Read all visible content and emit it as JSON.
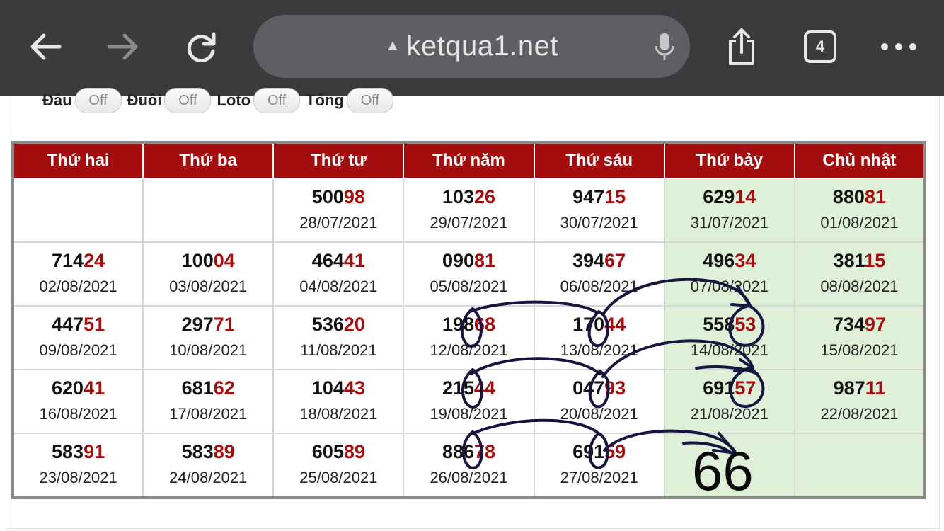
{
  "browser": {
    "url": "ketqua1.net",
    "tab_count": "4",
    "icons": [
      "back-icon",
      "forward-icon",
      "reload-icon",
      "warning-icon",
      "mic-icon",
      "share-icon",
      "tabs-icon",
      "more-icon"
    ]
  },
  "toggles": [
    {
      "label": "Đầu",
      "state": "Off"
    },
    {
      "label": "Đuôi",
      "state": "Off"
    },
    {
      "label": "Loto",
      "state": "Off"
    },
    {
      "label": "Tổng",
      "state": "Off"
    }
  ],
  "table": {
    "headers": [
      "Thứ hai",
      "Thứ ba",
      "Thứ tư",
      "Thứ năm",
      "Thứ sáu",
      "Thứ bảy",
      "Chủ nhật"
    ],
    "rows": [
      [
        null,
        null,
        {
          "pre": "500",
          "hl": "98",
          "date": "28/07/2021"
        },
        {
          "pre": "103",
          "hl": "26",
          "date": "29/07/2021"
        },
        {
          "pre": "947",
          "hl": "15",
          "date": "30/07/2021"
        },
        {
          "pre": "629",
          "hl": "14",
          "date": "31/07/2021"
        },
        {
          "pre": "880",
          "hl": "81",
          "date": "01/08/2021"
        }
      ],
      [
        {
          "pre": "714",
          "hl": "24",
          "date": "02/08/2021"
        },
        {
          "pre": "100",
          "hl": "04",
          "date": "03/08/2021"
        },
        {
          "pre": "464",
          "hl": "41",
          "date": "04/08/2021"
        },
        {
          "pre": "090",
          "hl": "81",
          "date": "05/08/2021"
        },
        {
          "pre": "394",
          "hl": "67",
          "date": "06/08/2021"
        },
        {
          "pre": "496",
          "hl": "34",
          "date": "07/08/2021"
        },
        {
          "pre": "381",
          "hl": "15",
          "date": "08/08/2021"
        }
      ],
      [
        {
          "pre": "447",
          "hl": "51",
          "date": "09/08/2021"
        },
        {
          "pre": "297",
          "hl": "71",
          "date": "10/08/2021"
        },
        {
          "pre": "536",
          "hl": "20",
          "date": "11/08/2021"
        },
        {
          "pre": "198",
          "hl": "68",
          "date": "12/08/2021"
        },
        {
          "pre": "170",
          "hl": "44",
          "date": "13/08/2021"
        },
        {
          "pre": "558",
          "hl": "53",
          "date": "14/08/2021"
        },
        {
          "pre": "734",
          "hl": "97",
          "date": "15/08/2021"
        }
      ],
      [
        {
          "pre": "620",
          "hl": "41",
          "date": "16/08/2021"
        },
        {
          "pre": "681",
          "hl": "62",
          "date": "17/08/2021"
        },
        {
          "pre": "104",
          "hl": "43",
          "date": "18/08/2021"
        },
        {
          "pre": "215",
          "hl": "44",
          "date": "19/08/2021"
        },
        {
          "pre": "047",
          "hl": "93",
          "date": "20/08/2021"
        },
        {
          "pre": "691",
          "hl": "57",
          "date": "21/08/2021"
        },
        {
          "pre": "987",
          "hl": "11",
          "date": "22/08/2021"
        }
      ],
      [
        {
          "pre": "583",
          "hl": "91",
          "date": "23/08/2021"
        },
        {
          "pre": "583",
          "hl": "89",
          "date": "24/08/2021"
        },
        {
          "pre": "605",
          "hl": "89",
          "date": "25/08/2021"
        },
        {
          "pre": "886",
          "hl": "78",
          "date": "26/08/2021"
        },
        {
          "pre": "691",
          "hl": "59",
          "date": "27/08/2021"
        },
        null,
        null
      ]
    ]
  },
  "annotation": {
    "handwritten_number": "66",
    "ink_color": "#15153f"
  },
  "colors": {
    "header_red": "#a30d0d",
    "weekend_green": "#dff0d8",
    "browser_bar": "#3a3b3d"
  }
}
